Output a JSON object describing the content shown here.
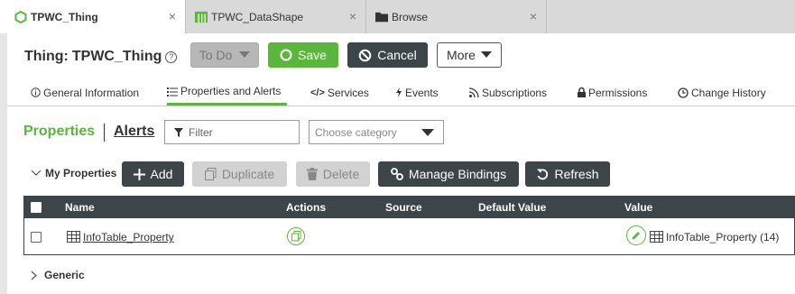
{
  "tabs": [
    {
      "label": "TPWC_Thing",
      "icon": "thing-hexagon-icon",
      "close": "×"
    },
    {
      "label": "TPWC_DataShape",
      "icon": "datashape-icon",
      "close": "×"
    },
    {
      "label": "Browse",
      "icon": "folder-icon",
      "close": "×"
    }
  ],
  "header": {
    "title_label": "Thing:",
    "title_name": "TPWC_Thing",
    "help": "?",
    "todo_label": "To Do",
    "save_label": "Save",
    "cancel_label": "Cancel",
    "more_label": "More"
  },
  "nav": [
    {
      "label": "General Information",
      "icon": "info-icon"
    },
    {
      "label": "Properties and Alerts",
      "icon": "list-icon"
    },
    {
      "label": "Services",
      "icon": "code-icon"
    },
    {
      "label": "Events",
      "icon": "bolt-icon"
    },
    {
      "label": "Subscriptions",
      "icon": "rss-icon"
    },
    {
      "label": "Permissions",
      "icon": "lock-icon"
    },
    {
      "label": "Change History",
      "icon": "clock-icon"
    }
  ],
  "sub": {
    "properties": "Properties",
    "alerts": "Alerts",
    "filter_placeholder": "Filter",
    "category_placeholder": "Choose category"
  },
  "toolbar": {
    "group_label": "My Properties",
    "add": "Add",
    "duplicate": "Duplicate",
    "delete": "Delete",
    "manage_bindings": "Manage Bindings",
    "refresh": "Refresh"
  },
  "table": {
    "headers": [
      "Name",
      "Actions",
      "Source",
      "Default Value",
      "Value"
    ],
    "rows": [
      {
        "name": "InfoTable_Property",
        "source": "",
        "default_value": "",
        "value": "InfoTable_Property (14)"
      }
    ]
  },
  "generic_label": "Generic",
  "colors": {
    "accent": "#5bb73b",
    "dark": "#3c4547"
  }
}
